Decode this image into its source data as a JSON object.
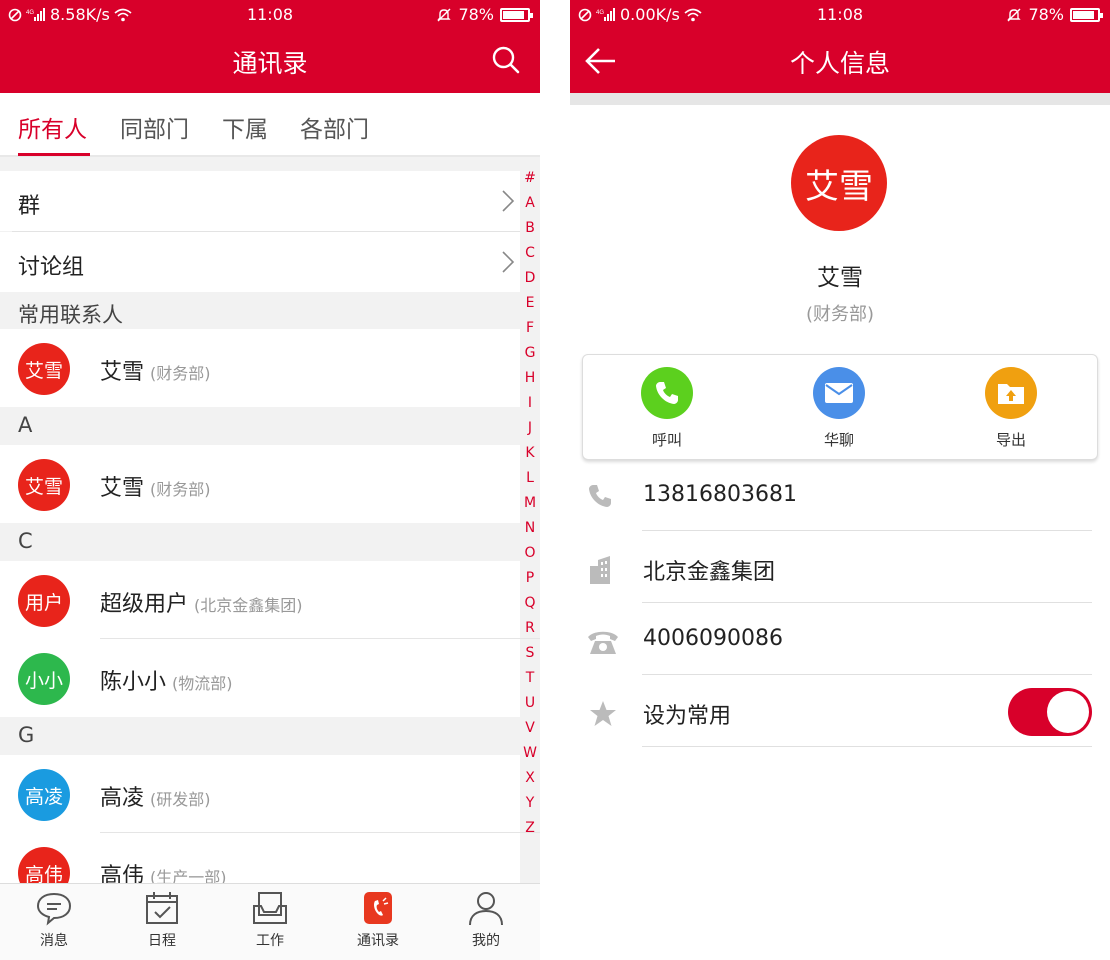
{
  "status_left": {
    "time": "11:08",
    "net_speed": "8.58K/s",
    "battery": "78%",
    "battery_level": 0.78
  },
  "status_right": {
    "time": "11:08",
    "net_speed": "0.00K/s",
    "battery": "78%",
    "battery_level": 0.78
  },
  "contacts_screen": {
    "title": "通讯录",
    "tabs": [
      "所有人",
      "同部门",
      "下属",
      "各部门"
    ],
    "active_tab": "所有人",
    "nav_rows": [
      "群",
      "讨论组"
    ],
    "sections": [
      {
        "header": "常用联系人",
        "contacts": [
          {
            "avatar": "艾雪",
            "name": "艾雪",
            "dept": "(财务部)",
            "color": "#e8241b"
          }
        ]
      },
      {
        "header": "A",
        "contacts": [
          {
            "avatar": "艾雪",
            "name": "艾雪",
            "dept": "(财务部)",
            "color": "#e8241b"
          }
        ]
      },
      {
        "header": "C",
        "contacts": [
          {
            "avatar": "用户",
            "name": "超级用户",
            "dept": "(北京金鑫集团)",
            "color": "#e8241b"
          },
          {
            "avatar": "小小",
            "name": "陈小小",
            "dept": "(物流部)",
            "color": "#2db84d"
          }
        ]
      },
      {
        "header": "G",
        "contacts": [
          {
            "avatar": "高凌",
            "name": "高凌",
            "dept": "(研发部)",
            "color": "#1a9be0"
          },
          {
            "avatar": "高伟",
            "name": "高伟",
            "dept": "(生产一部)",
            "color": "#e8241b"
          }
        ]
      }
    ],
    "index_letters": [
      "#",
      "A",
      "B",
      "C",
      "D",
      "E",
      "F",
      "G",
      "H",
      "I",
      "J",
      "K",
      "L",
      "M",
      "N",
      "O",
      "P",
      "Q",
      "R",
      "S",
      "T",
      "U",
      "V",
      "W",
      "X",
      "Y",
      "Z"
    ],
    "tabbar": [
      "消息",
      "日程",
      "工作",
      "通讯录",
      "我的"
    ]
  },
  "profile_screen": {
    "title": "个人信息",
    "avatar": "艾雪",
    "name": "艾雪",
    "dept": "(财务部)",
    "actions": [
      "呼叫",
      "华聊",
      "导出"
    ],
    "mobile": "13816803681",
    "company": "北京金鑫集团",
    "phone": "4006090086",
    "favorite_label": "设为常用",
    "favorite_on": true
  },
  "colors": {
    "brand_red": "#d8002a",
    "green": "#5cd01e",
    "blue": "#4a8fe8",
    "orange": "#f0a010"
  }
}
